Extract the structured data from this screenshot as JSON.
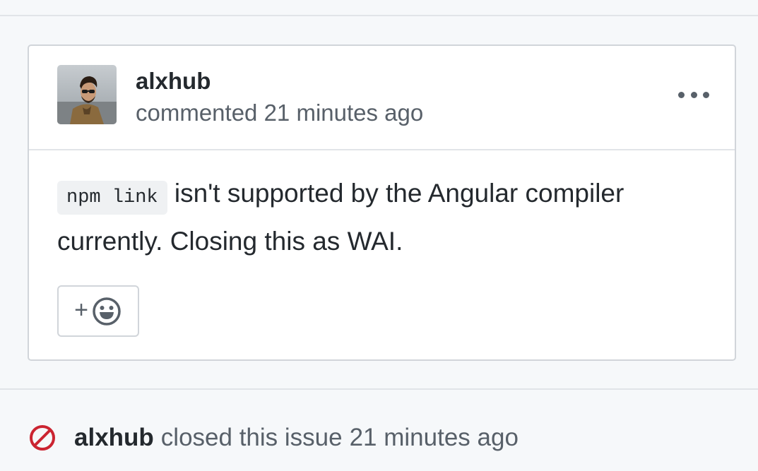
{
  "comment": {
    "author": "alxhub",
    "meta": "commented 21 minutes ago",
    "avatar_icon": "user-avatar-photo",
    "more_icon": "kebab-more-icon",
    "body": {
      "code": "npm link",
      "text": "isn't supported by the Angular compiler currently. Closing this as WAI."
    },
    "reaction": {
      "plus_label": "+",
      "icon": "smiley-icon"
    }
  },
  "event": {
    "icon": "closed-circle-slash-icon",
    "author": "alxhub",
    "text": "closed this issue",
    "time": "21 minutes ago",
    "icon_color": "#cb2431"
  }
}
